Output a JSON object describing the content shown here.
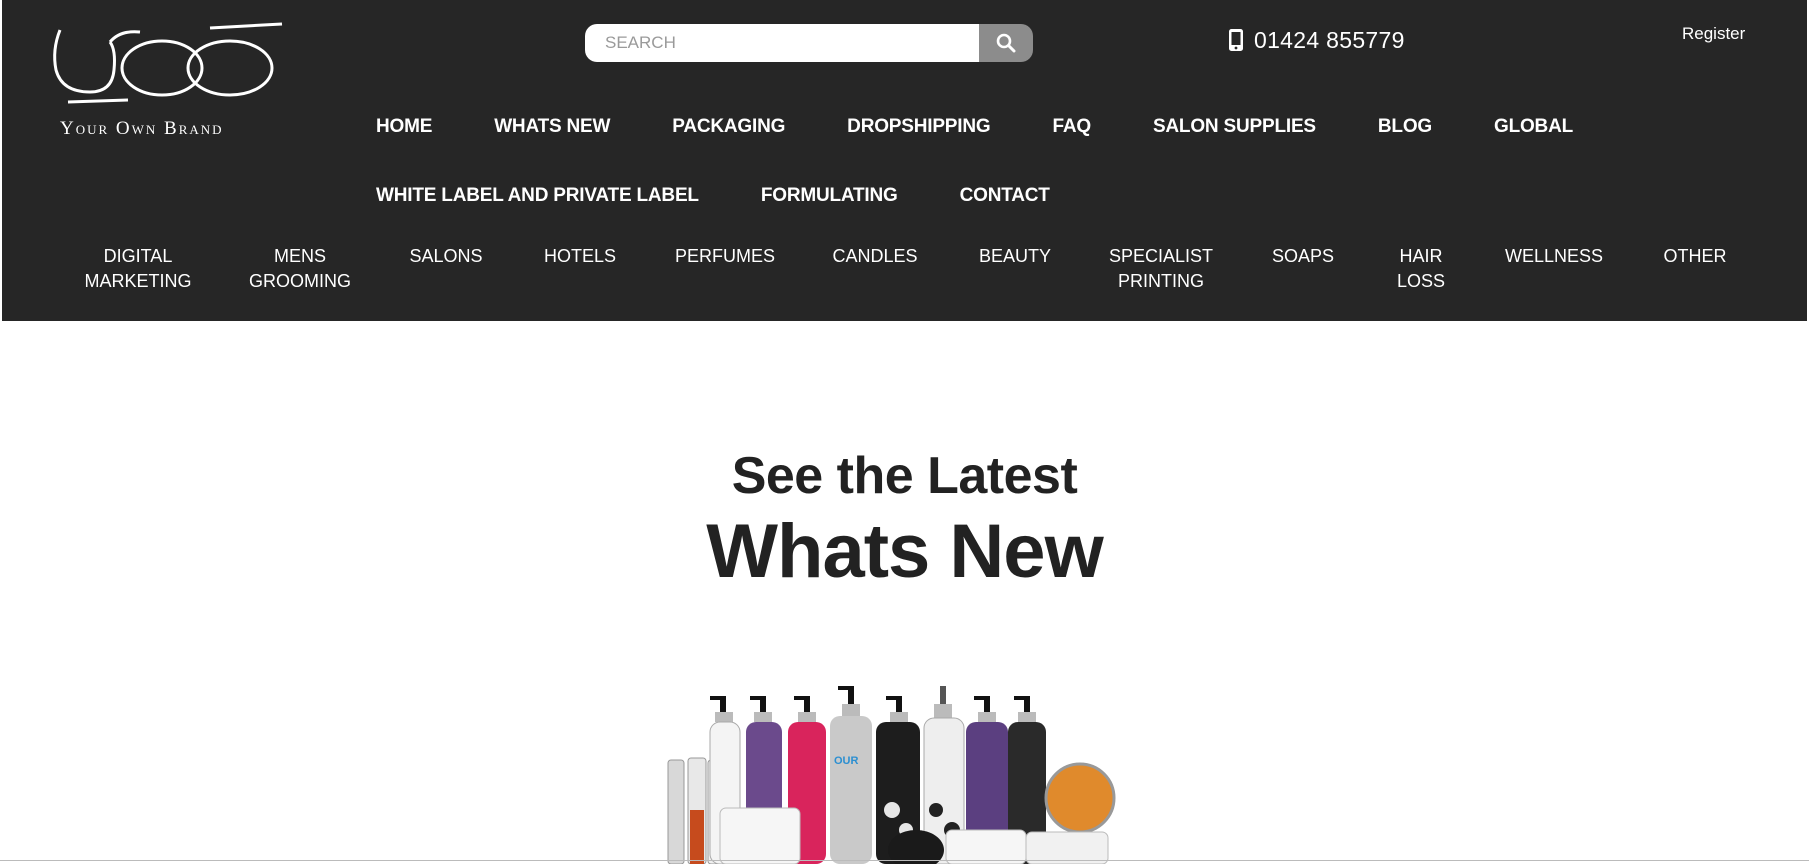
{
  "brand": {
    "logo_text": "Your Own Brand",
    "logo_mark": "yob-monogram"
  },
  "search": {
    "placeholder": "SEARCH",
    "button_icon": "search-icon"
  },
  "contact": {
    "phone_icon": "mobile-phone-icon",
    "phone": "01424 855779"
  },
  "account": {
    "register_label": "Register"
  },
  "main_nav": {
    "row1": [
      "HOME",
      "WHATS NEW",
      "PACKAGING",
      "DROPSHIPPING",
      "FAQ",
      "SALON SUPPLIES",
      "BLOG",
      "GLOBAL"
    ],
    "row2": [
      "WHITE LABEL AND PRIVATE LABEL",
      "FORMULATING",
      "CONTACT"
    ]
  },
  "sub_nav": [
    {
      "line1": "DIGITAL",
      "line2": "MARKETING"
    },
    {
      "line1": "MENS",
      "line2": "GROOMING"
    },
    {
      "line1": "SALONS",
      "line2": ""
    },
    {
      "line1": "HOTELS",
      "line2": ""
    },
    {
      "line1": "PERFUMES",
      "line2": ""
    },
    {
      "line1": "CANDLES",
      "line2": ""
    },
    {
      "line1": "BEAUTY",
      "line2": ""
    },
    {
      "line1": "SPECIALIST",
      "line2": "PRINTING"
    },
    {
      "line1": "SOAPS",
      "line2": ""
    },
    {
      "line1": "HAIR",
      "line2": "LOSS"
    },
    {
      "line1": "WELLNESS",
      "line2": ""
    },
    {
      "line1": "OTHER",
      "line2": ""
    }
  ],
  "hero": {
    "subtitle": "See the Latest",
    "title": "Whats New"
  },
  "colors": {
    "header_bg": "#262626",
    "text_dark": "#222222",
    "search_button": "#8c8c8c"
  }
}
